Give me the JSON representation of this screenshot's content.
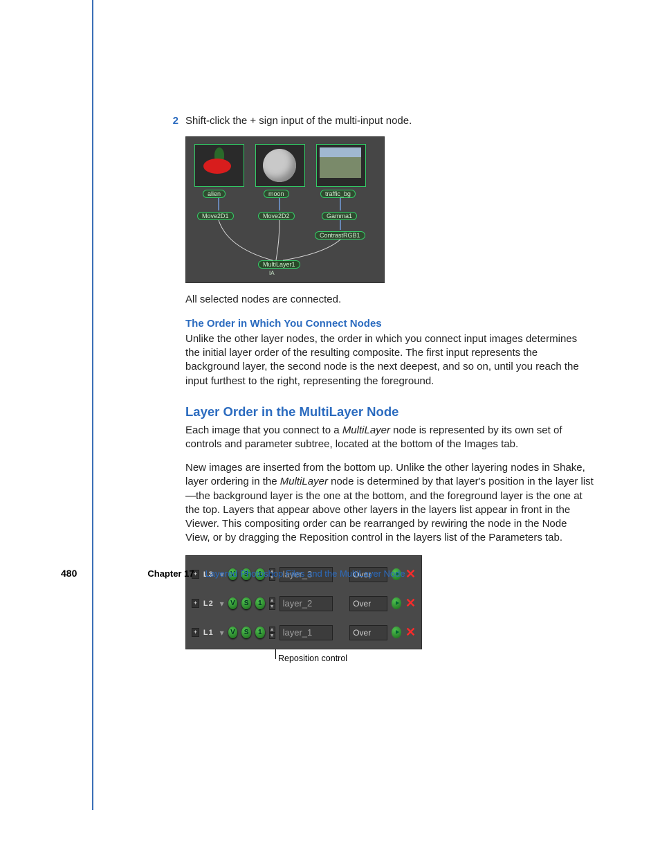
{
  "step": {
    "num": "2",
    "text": "Shift-click the + sign input of the multi-input node."
  },
  "node_view": {
    "thumbs": [
      "alien",
      "moon",
      "traffic_bg"
    ],
    "mid_nodes": [
      "Move2D1",
      "Move2D2",
      "Gamma1"
    ],
    "extra_node": "ContrastRGB1",
    "target_node": "MultiLayer1",
    "port_label": "IA"
  },
  "afterstep": "All selected nodes are connected.",
  "sub1_title": "The Order in Which You Connect Nodes",
  "sub1_body": "Unlike the other layer nodes, the order in which you connect input images determines the initial layer order of the resulting composite. The first input represents the background layer, the second node is the next deepest, and so on, until you reach the input furthest to the right, representing the foreground.",
  "h2": "Layer Order in the MultiLayer Node",
  "p1a": "Each image that you connect to a ",
  "p1_em": "MultiLayer",
  "p1b": " node is represented by its own set of controls and parameter subtree, located at the bottom of the Images tab.",
  "p2a": "New images are inserted from the bottom up. Unlike the other layering nodes in Shake, layer ordering in the ",
  "p2_em": "MultiLayer",
  "p2b": " node is determined by that layer's position in the layer list—the background layer is the one at the bottom, and the foreground layer is the one at the top. Layers that appear above other layers in the layers list appear in front in the Viewer. This compositing order can be rearranged by rewiring the node in the Node View, or by dragging the Reposition control in the layers list of the Parameters tab.",
  "layers": [
    {
      "tag": "L3",
      "name": "layer_3",
      "mode": "Over"
    },
    {
      "tag": "L2",
      "name": "layer_2",
      "mode": "Over"
    },
    {
      "tag": "L1",
      "name": "layer_1",
      "mode": "Over"
    }
  ],
  "ctrl": {
    "v": "V",
    "s": "S",
    "o": "1"
  },
  "callout": "Reposition control",
  "footer": {
    "page": "480",
    "chapter": "Chapter 17",
    "title": "Layered Photoshop Files and the MultiLayer Node"
  }
}
